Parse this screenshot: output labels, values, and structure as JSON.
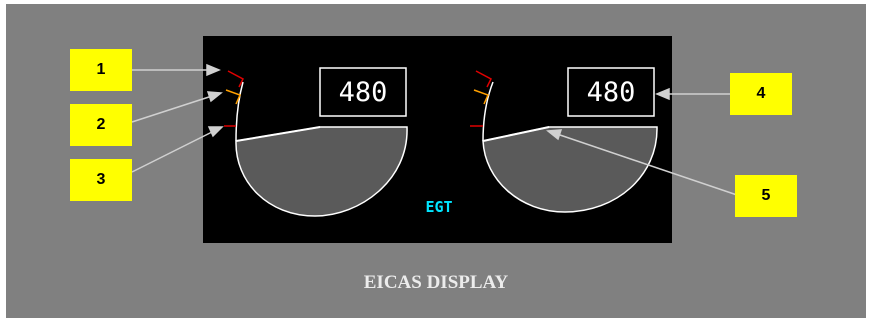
{
  "display": {
    "left_egt_value": "480",
    "right_egt_value": "480",
    "gauge_label": "EGT",
    "caption": "EICAS DISPLAY"
  },
  "callouts": [
    {
      "label": "1"
    },
    {
      "label": "2"
    },
    {
      "label": "3"
    },
    {
      "label": "4"
    },
    {
      "label": "5"
    }
  ],
  "colors": {
    "panel": "#808080",
    "screen": "#000000",
    "callout_fill": "#ffff00",
    "redline": "#e00000",
    "amber_limit": "#ffa000",
    "cyan_label": "#00e5ff",
    "needle_and_arc": "#ffffff",
    "gauge_fill": "#5a5a5a",
    "leader_line": "#d0d0d0"
  }
}
